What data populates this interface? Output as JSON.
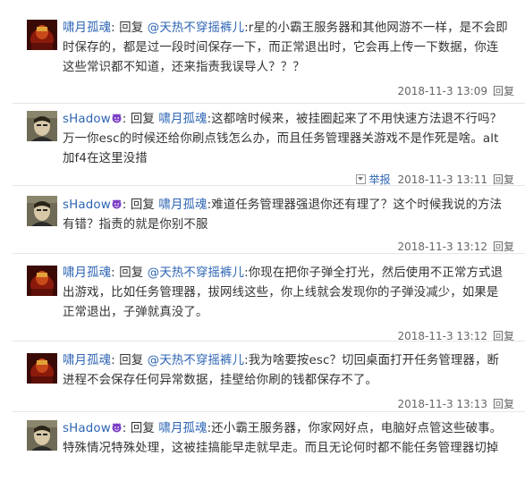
{
  "reply_word": "回复",
  "colon": ":",
  "replies": [
    {
      "author": "啸月孤魂",
      "target": "@天热不穿摇裤儿",
      "text": ":r星的小霸王服务器和其他网游不一样，是不会即时保存的，都是过一段时间保存一下，而正常退出时，它会再上传一下数据，你连这些常识都不知道，还来指责我误导人？？？",
      "time": "2018-11-3 13:09",
      "reply_label": "回复",
      "avatar": "dark-red",
      "show_report": false
    },
    {
      "author": "sHadow",
      "target": "啸月孤魂",
      "text": ":这都啥时候来，被挂圈起来了不用快速方法退不行吗？万一你esc的时候还给你刷点钱怎么办，而且任务管理器关游戏不是作死是啥。alt加f4在这里没措",
      "time": "2018-11-3 13:11",
      "reply_label": "回复",
      "avatar": "portrait",
      "show_report": true,
      "report_label": "举报"
    },
    {
      "author": "sHadow",
      "target": "啸月孤魂",
      "text": ":难道任务管理器强退你还有理了？这个时候我说的方法有错？指责的就是你别不服",
      "time": "2018-11-3 13:12",
      "reply_label": "回复",
      "avatar": "portrait",
      "show_report": false
    },
    {
      "author": "啸月孤魂",
      "target": "@天热不穿摇裤儿",
      "text": ":你现在把你子弹全打光，然后使用不正常方式退出游戏，比如任务管理器，拔网线这些，你上线就会发现你的子弹没减少，如果是正常退出，子弹就真没了。",
      "time": "2018-11-3 13:12",
      "reply_label": "回复",
      "avatar": "dark-red",
      "show_report": false
    },
    {
      "author": "啸月孤魂",
      "target": "@天热不穿摇裤儿",
      "text": ":我为啥要按esc？切回桌面打开任务管理器，断进程不会保存任何异常数据，挂壁给你刷的钱都保存不了。",
      "time": "2018-11-3 13:13",
      "reply_label": "回复",
      "avatar": "dark-red",
      "show_report": false
    },
    {
      "author": "sHadow",
      "target": "啸月孤魂",
      "text": ":还小霸王服务器，你家网好点，电脑好点管这些破事。特殊情况特殊处理，这被挂搞能早走就早走。而且无论何时都不能任务管理器切掉",
      "time": "",
      "reply_label": "",
      "avatar": "portrait",
      "show_report": false
    }
  ]
}
